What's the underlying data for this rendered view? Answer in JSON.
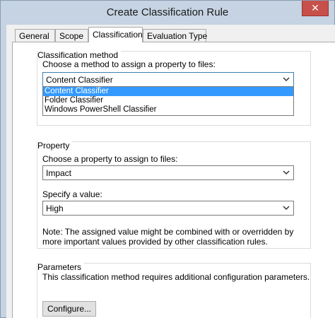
{
  "window": {
    "title": "Create Classification Rule",
    "close_glyph": "✕"
  },
  "tabs": [
    {
      "label": "General"
    },
    {
      "label": "Scope"
    },
    {
      "label": "Classification"
    },
    {
      "label": "Evaluation Type"
    }
  ],
  "classification_method": {
    "group_label": "Classification method",
    "prompt": "Choose a method to assign a property to files:",
    "selected_value": "Content Classifier",
    "options": [
      "Content Classifier",
      "Folder Classifier",
      "Windows PowerShell Classifier"
    ]
  },
  "property": {
    "group_label": "Property",
    "choose_label": "Choose a property to assign to files:",
    "property_value": "Impact",
    "value_label": "Specify a value:",
    "value_value": "High",
    "note": "Note: The assigned value might be combined with or overridden by more important values provided by other classification rules."
  },
  "parameters": {
    "group_label": "Parameters",
    "description": "This classification method requires additional configuration parameters.",
    "configure_label": "Configure..."
  },
  "icons": {
    "dropdown": "chevron-down-icon",
    "close": "close-icon"
  }
}
